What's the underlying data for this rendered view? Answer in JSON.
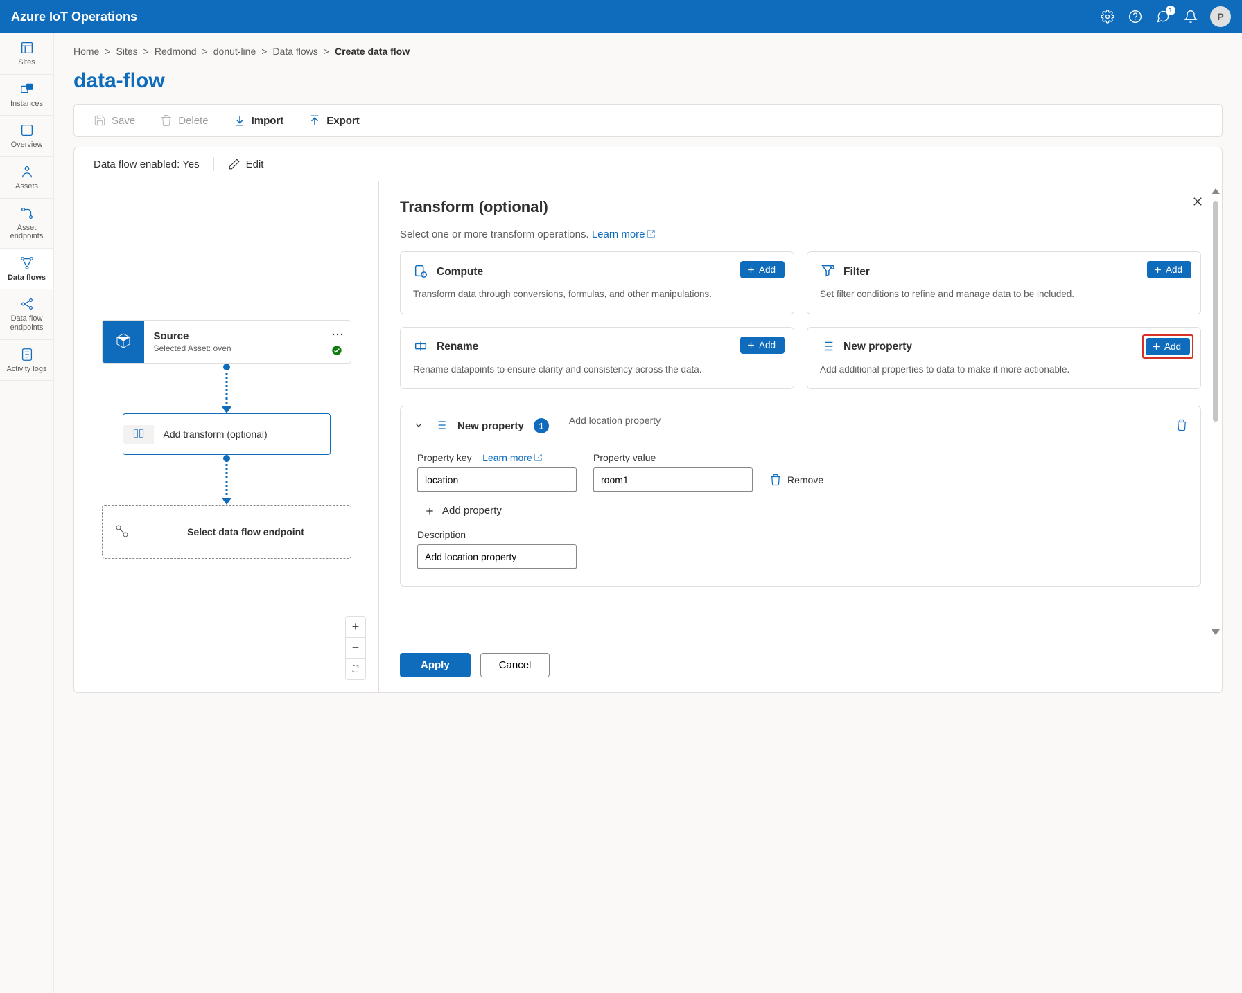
{
  "brand": "Azure IoT Operations",
  "avatar_initial": "P",
  "notif_count": "1",
  "nav": {
    "sites": "Sites",
    "instances": "Instances",
    "overview": "Overview",
    "assets": "Assets",
    "asset_endpoints": "Asset endpoints",
    "data_flows": "Data flows",
    "data_flow_endpoints": "Data flow endpoints",
    "activity_logs": "Activity logs"
  },
  "breadcrumb": {
    "home": "Home",
    "sites": "Sites",
    "loc": "Redmond",
    "instance": "donut-line",
    "section": "Data flows",
    "current": "Create data flow"
  },
  "page_title": "data-flow",
  "toolbar": {
    "save": "Save",
    "delete": "Delete",
    "import": "Import",
    "export": "Export"
  },
  "status": {
    "text": "Data flow enabled: Yes",
    "edit": "Edit"
  },
  "flow": {
    "source_title": "Source",
    "source_sub": "Selected Asset: oven",
    "transform": "Add transform (optional)",
    "endpoint": "Select data flow endpoint"
  },
  "zoom": {
    "in": "+",
    "out": "−",
    "fit": "⛶"
  },
  "panel": {
    "title": "Transform (optional)",
    "subtitle": "Select one or more transform operations.",
    "learn_more": "Learn more",
    "add": "Add",
    "ops": {
      "compute": {
        "name": "Compute",
        "desc": "Transform data through conversions, formulas, and other manipulations."
      },
      "filter": {
        "name": "Filter",
        "desc": "Set filter conditions to refine and manage data to be included."
      },
      "rename": {
        "name": "Rename",
        "desc": "Rename datapoints to ensure clarity and consistency across the data."
      },
      "newprop": {
        "name": "New property",
        "desc": "Add additional properties to data to make it more actionable."
      }
    },
    "accordion": {
      "name": "New property",
      "count": "1",
      "subtitle": "Add location property",
      "prop_key_label": "Property key",
      "learn_more": "Learn more",
      "prop_value_label": "Property value",
      "key_value": "location",
      "val_value": "room1",
      "remove": "Remove",
      "add_property": "Add property",
      "description_label": "Description",
      "description_value": "Add location property"
    },
    "apply": "Apply",
    "cancel": "Cancel"
  }
}
